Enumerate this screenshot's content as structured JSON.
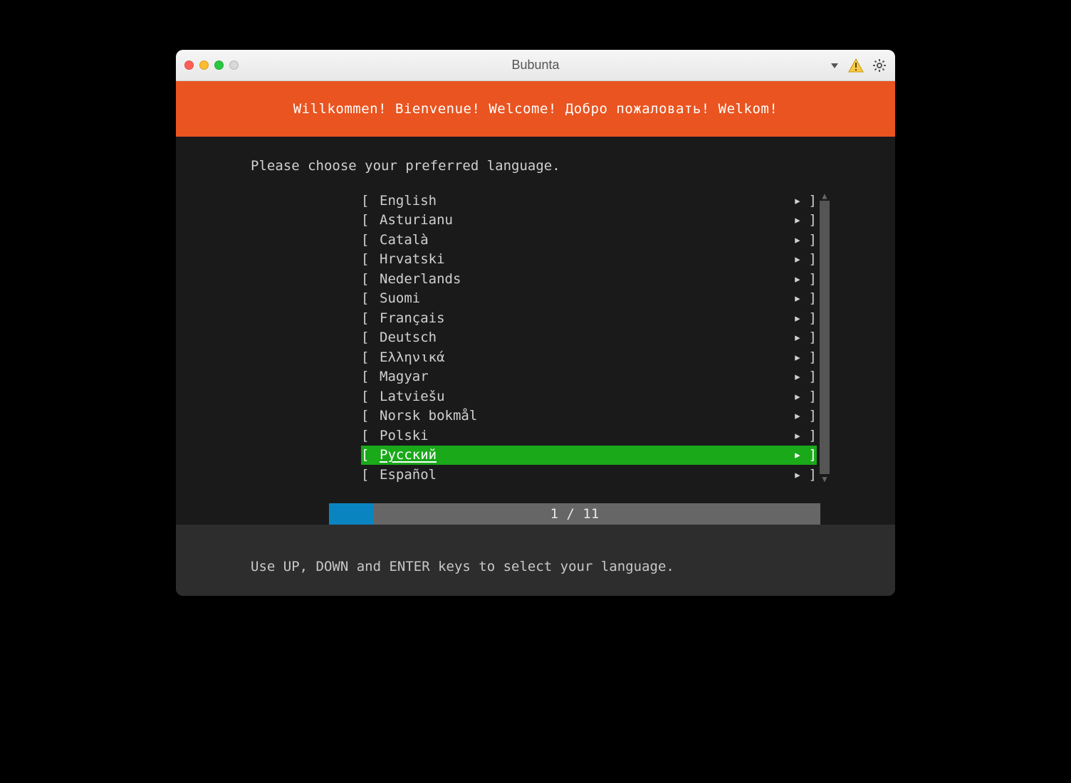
{
  "window": {
    "title": "Bubunta"
  },
  "header": {
    "welcome": "Willkommen! Bienvenue! Welcome! Добро пожаловать! Welkom!"
  },
  "prompt": "Please choose your preferred language.",
  "languages": [
    {
      "name": "English",
      "selected": false
    },
    {
      "name": "Asturianu",
      "selected": false
    },
    {
      "name": "Català",
      "selected": false
    },
    {
      "name": "Hrvatski",
      "selected": false
    },
    {
      "name": "Nederlands",
      "selected": false
    },
    {
      "name": "Suomi",
      "selected": false
    },
    {
      "name": "Français",
      "selected": false
    },
    {
      "name": "Deutsch",
      "selected": false
    },
    {
      "name": "Ελληνικά",
      "selected": false
    },
    {
      "name": "Magyar",
      "selected": false
    },
    {
      "name": "Latviešu",
      "selected": false
    },
    {
      "name": "Norsk bokmål",
      "selected": false
    },
    {
      "name": "Polski",
      "selected": false
    },
    {
      "name": "Русский",
      "selected": true
    },
    {
      "name": "Español",
      "selected": false
    }
  ],
  "progress": {
    "current": 1,
    "total": 11,
    "label": "1 / 11"
  },
  "footer": {
    "hint": "Use UP, DOWN and ENTER keys to select your language."
  },
  "glyphs": {
    "lbracket": "[ ",
    "rbracket": "]",
    "arrow": "▸"
  }
}
